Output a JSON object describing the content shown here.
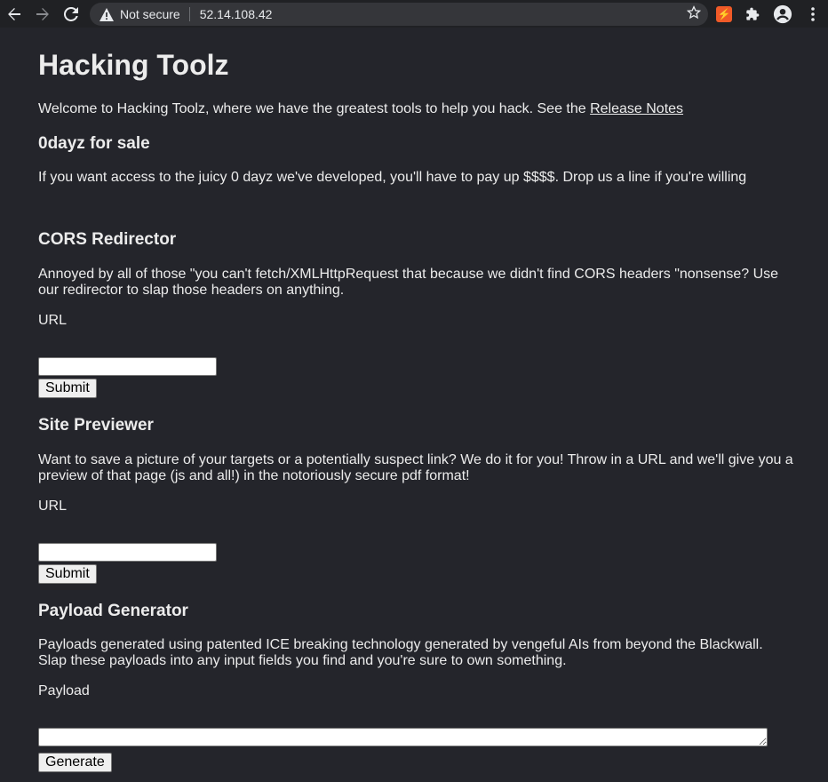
{
  "browser": {
    "security_label": "Not secure",
    "url": "52.14.108.42"
  },
  "page": {
    "title": "Hacking Toolz",
    "intro": "Welcome to Hacking Toolz, where we have the greatest tools to help you hack. See the ",
    "release_notes_link": "Release Notes"
  },
  "sections": {
    "zerodayz": {
      "heading": "0dayz for sale",
      "body": "If you want access to the juicy 0 dayz we've developed, you'll have to pay up $$$$. Drop us a line if you're willing"
    },
    "cors": {
      "heading": "CORS Redirector",
      "body": "Annoyed by all of those \"you can't fetch/XMLHttpRequest that because we didn't find CORS headers \"nonsense? Use our redirector to slap those headers on anything.",
      "field_label": "URL",
      "field_value": "",
      "button": "Submit"
    },
    "previewer": {
      "heading": "Site Previewer",
      "body": "Want to save a picture of your targets or a potentially suspect link? We do it for you! Throw in a URL and we'll give you a preview of that page (js and all!) in the notoriously secure pdf format!",
      "field_label": "URL",
      "field_value": "",
      "button": "Submit"
    },
    "payload": {
      "heading": "Payload Generator",
      "body": "Payloads generated using patented ICE breaking technology generated by vengeful AIs from beyond the Blackwall. Slap these payloads into any input fields you find and you're sure to own something.",
      "field_label": "Payload",
      "field_value": "",
      "button": "Generate"
    }
  },
  "colors": {
    "background": "#24252b",
    "chrome": "#202124",
    "omnibox": "#35363a",
    "text": "#ececec",
    "extension_accent": "#f05a28"
  },
  "icons": [
    "back-arrow-icon",
    "forward-arrow-icon",
    "reload-icon",
    "warning-icon",
    "star-icon",
    "lightning-extension-icon",
    "puzzle-icon",
    "profile-icon",
    "kebab-menu-icon"
  ]
}
